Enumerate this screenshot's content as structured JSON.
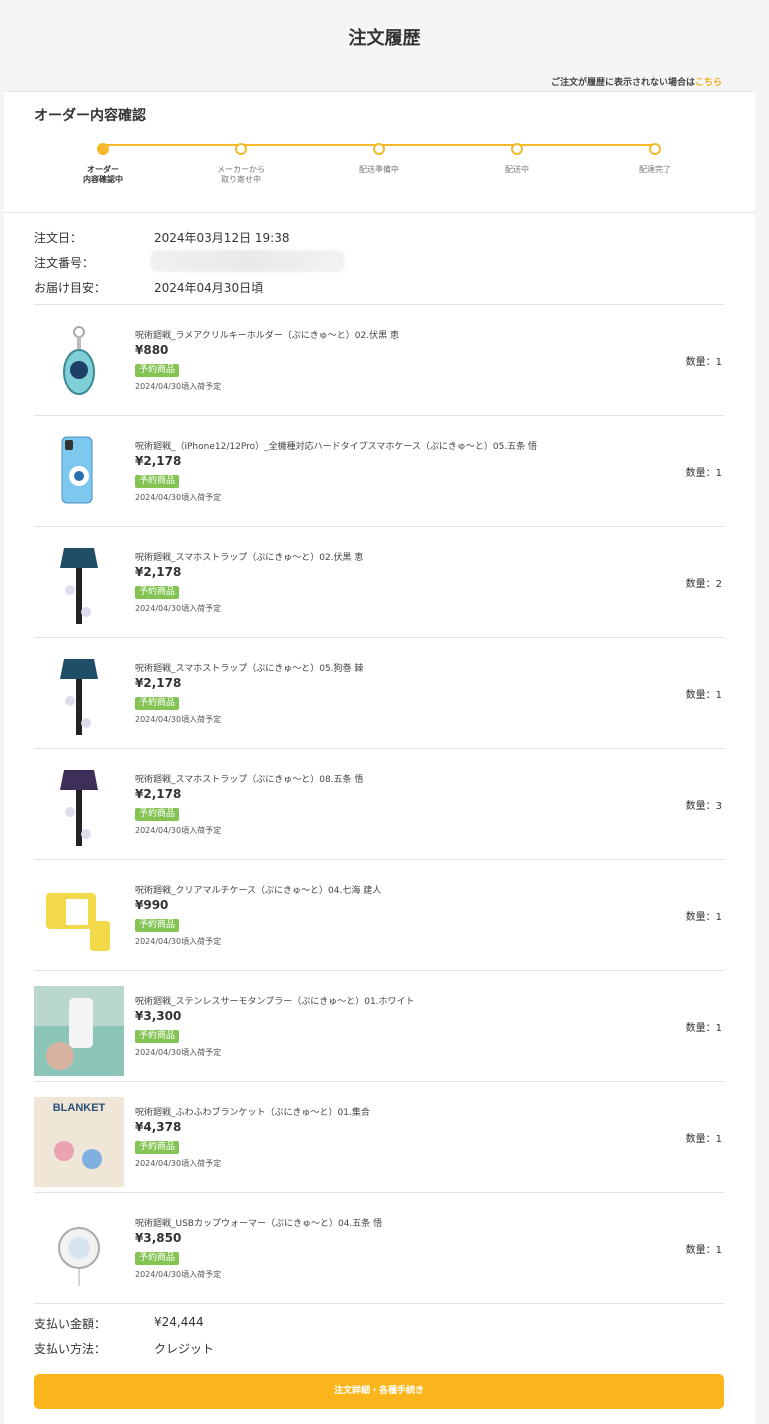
{
  "header": {
    "title": "注文履歴",
    "hint_text": "ご注文が履歴に表示されない場合は",
    "hint_link": "こちら"
  },
  "status": {
    "section_title": "オーダー内容確認",
    "steps": [
      {
        "label": "オーダー\n内容確認中",
        "active": true
      },
      {
        "label": "メーカーから\n取り寄せ中",
        "active": false
      },
      {
        "label": "配送準備中",
        "active": false
      },
      {
        "label": "配送中",
        "active": false
      },
      {
        "label": "配達完了",
        "active": false
      }
    ]
  },
  "order": {
    "date_label": "注文日：",
    "date_value": "2024年03月12日 19:38",
    "number_label": "注文番号：",
    "delivery_label": "お届け目安：",
    "delivery_value": "2024年04月30日頃"
  },
  "items": [
    {
      "name": "呪術廻戦_ラメアクリルキーホルダー（ぷにきゅ〜と）02.伏黒 恵",
      "price": "¥880",
      "badge": "予約商品",
      "date": "2024/04/30頃入荷予定",
      "qty": "数量：1",
      "thumb": "keychain"
    },
    {
      "name": "呪術廻戦_（iPhone12/12Pro）_全機種対応ハードタイプスマホケース（ぷにきゅ〜と）05.五条 悟",
      "price": "¥2,178",
      "badge": "予約商品",
      "date": "2024/04/30頃入荷予定",
      "qty": "数量：1",
      "thumb": "phonecase"
    },
    {
      "name": "呪術廻戦_スマホストラップ（ぷにきゅ〜と）02.伏黒 恵",
      "price": "¥2,178",
      "badge": "予約商品",
      "date": "2024/04/30頃入荷予定",
      "qty": "数量：2",
      "thumb": "strap",
      "color": "#1f4f66"
    },
    {
      "name": "呪術廻戦_スマホストラップ（ぷにきゅ〜と）05.狗巻 棘",
      "price": "¥2,178",
      "badge": "予約商品",
      "date": "2024/04/30頃入荷予定",
      "qty": "数量：1",
      "thumb": "strap",
      "color": "#1f4f66"
    },
    {
      "name": "呪術廻戦_スマホストラップ（ぷにきゅ〜と）08.五条 悟",
      "price": "¥2,178",
      "badge": "予約商品",
      "date": "2024/04/30頃入荷予定",
      "qty": "数量：3",
      "thumb": "strap",
      "color": "#3e2f5a"
    },
    {
      "name": "呪術廻戦_クリアマルチケース（ぷにきゅ〜と）04.七海 建人",
      "price": "¥990",
      "badge": "予約商品",
      "date": "2024/04/30頃入荷予定",
      "qty": "数量：1",
      "thumb": "multicase"
    },
    {
      "name": "呪術廻戦_ステンレスサーモタンブラー（ぷにきゅ〜と）01.ホワイト",
      "price": "¥3,300",
      "badge": "予約商品",
      "date": "2024/04/30頃入荷予定",
      "qty": "数量：1",
      "thumb": "tumbler"
    },
    {
      "name": "呪術廻戦_ふわふわブランケット（ぷにきゅ〜と）01.集合",
      "price": "¥4,378",
      "badge": "予約商品",
      "date": "2024/04/30頃入荷予定",
      "qty": "数量：1",
      "thumb": "blanket",
      "thumb_text": "BLANKET"
    },
    {
      "name": "呪術廻戦_USBカップウォーマー（ぷにきゅ〜と）04.五条 悟",
      "price": "¥3,850",
      "badge": "予約商品",
      "date": "2024/04/30頃入荷予定",
      "qty": "数量：1",
      "thumb": "warmer"
    }
  ],
  "payment": {
    "total_label": "支払い金額：",
    "total_value": "¥24,444",
    "method_label": "支払い方法：",
    "method_value": "クレジット"
  },
  "cta_label": "注文詳細・各種手続き",
  "colors": {
    "accent": "#f5b92a",
    "badge": "#84c455",
    "link": "#f2a91b",
    "button": "#fbb51c"
  }
}
